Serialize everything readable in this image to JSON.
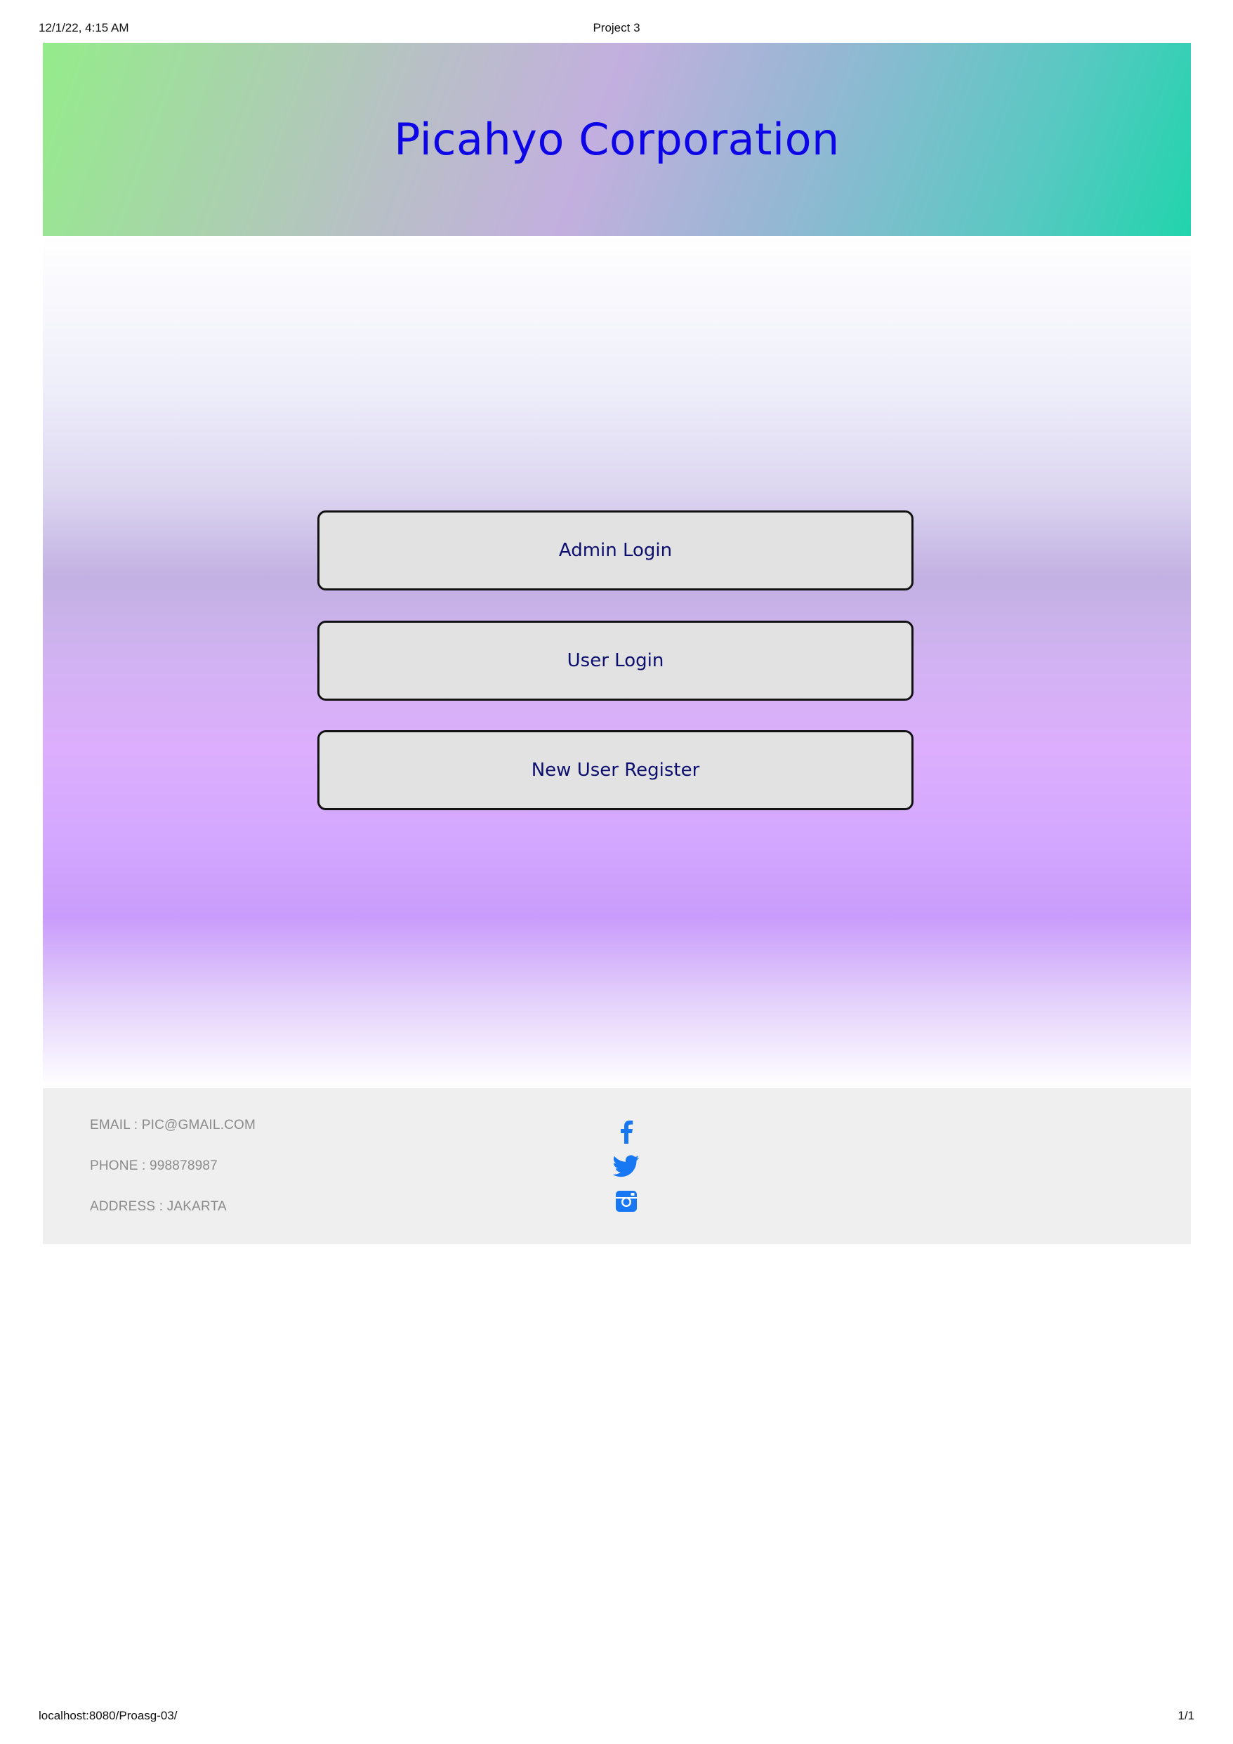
{
  "print_header": {
    "date": "12/1/22, 4:15 AM",
    "title": "Project 3"
  },
  "print_footer": {
    "url": "localhost:8080/Proasg-03/",
    "page": "1/1"
  },
  "banner": {
    "brand": "Picahyo Corporation"
  },
  "actions": {
    "admin_login": "Admin Login",
    "user_login": "User Login",
    "new_user_register": "New User Register"
  },
  "footer": {
    "email": "EMAIL : PIC@GMAIL.COM",
    "phone": "PHONE : 998878987",
    "address": "ADDRESS : JAKARTA",
    "social_icons": [
      "facebook-icon",
      "twitter-icon",
      "instagram-icon"
    ]
  },
  "colors": {
    "brand_text": "#0d05e6",
    "button_text": "#0d0f6e",
    "button_bg": "#e3e2e2",
    "social_icon": "#1877f2",
    "footer_bg": "#efefef"
  }
}
